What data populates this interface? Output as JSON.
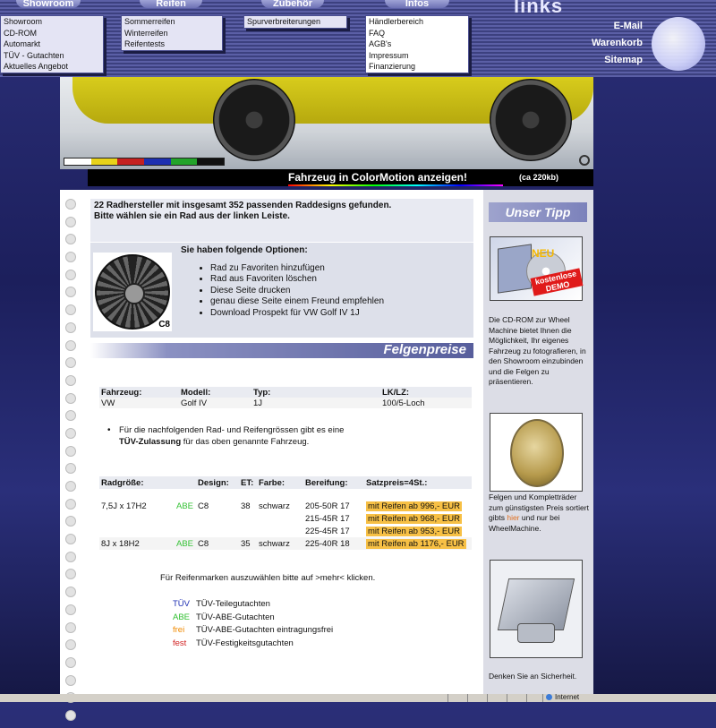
{
  "nav": {
    "tabs": [
      {
        "label": "Showroom"
      },
      {
        "label": "Reifen"
      },
      {
        "label": "Zubehör"
      },
      {
        "label": "Infos"
      }
    ],
    "logo": "links",
    "menus": {
      "showroom": [
        "Showroom",
        "CD-ROM",
        "Automarkt",
        "TÜV - Gutachten",
        "Aktuelles Angebot"
      ],
      "reifen": [
        "Sommerreifen",
        "Winterreifen",
        "Reifentests"
      ],
      "zubehoer": [
        "Spurverbreiterungen"
      ],
      "infos": [
        "Händlerbereich",
        "FAQ",
        "AGB's",
        "Impressum",
        "Finanzierung"
      ]
    },
    "right_links": [
      "E-Mail",
      "Warenkorb",
      "Sitemap"
    ]
  },
  "hero": {
    "colormotion_label": "Fahrzeug in ColorMotion anzeigen!",
    "colormotion_size": "(ca 220kb)",
    "swatch_colors": [
      "#ffffff",
      "#e8d21a",
      "#c42020",
      "#1d2fb0",
      "#23a32a",
      "#111111"
    ]
  },
  "intro": {
    "line1": "22 Radhersteller mit insgesamt 352 passenden Raddesigns gefunden.",
    "line2": "Bitte wählen sie ein Rad aus der linken Leiste."
  },
  "options": {
    "title": "Sie haben folgende Optionen:",
    "rim_label": "C8",
    "items": [
      "Rad zu Favoriten hinzufügen",
      "Rad aus Favoriten löschen",
      "Diese Seite drucken",
      "genau diese Seite einem Freund empfehlen",
      "Download Prospekt für VW Golf IV 1J"
    ]
  },
  "felgenpreise_title": "Felgenpreise",
  "vehicle": {
    "headers": [
      "Fahrzeug:",
      "Modell:",
      "Typ:",
      "LK/LZ:"
    ],
    "values": [
      "VW",
      "Golf IV",
      "1J",
      "100/5-Loch"
    ]
  },
  "note": {
    "text": "Für die nachfolgenden Rad- und Reifengrössen gibt es eine",
    "bold": "TÜV-Zulassung",
    "text2": "für das oben genannte Fahrzeug."
  },
  "sizes": {
    "headers": [
      "Radgröße:",
      "Design:",
      "ET:",
      "Farbe:",
      "Bereifung:",
      "Satzpreis=4St.:"
    ],
    "rows": [
      {
        "size": "7,5J x 17H2",
        "cert": "ABE",
        "design": "C8",
        "et": "38",
        "farbe": "schwarz",
        "tyre": "205-50R 17",
        "price": "mit Reifen ab 996,- EUR"
      },
      {
        "size": "",
        "cert": "",
        "design": "",
        "et": "",
        "farbe": "",
        "tyre": "215-45R 17",
        "price": "mit Reifen ab 968,- EUR"
      },
      {
        "size": "",
        "cert": "",
        "design": "",
        "et": "",
        "farbe": "",
        "tyre": "225-45R 17",
        "price": "mit Reifen ab 953,- EUR"
      },
      {
        "size": "8J x 18H2",
        "cert": "ABE",
        "design": "C8",
        "et": "35",
        "farbe": "schwarz",
        "tyre": "225-40R 18",
        "price": "mit Reifen ab 1176,- EUR"
      }
    ]
  },
  "pick_text": "Für Reifenmarken auszuwählen bitte auf >mehr< klicken.",
  "legend": [
    {
      "key": "TÜV",
      "color": "#1e2fb3",
      "text": "TÜV-Teilegutachten"
    },
    {
      "key": "ABE",
      "color": "#2fbf2f",
      "text": "TÜV-ABE-Gutachten"
    },
    {
      "key": "frei",
      "color": "#f08a00",
      "text": "TÜV-ABE-Gutachten eintragungsfrei"
    },
    {
      "key": "fest",
      "color": "#d11f1f",
      "text": "TÜV-Festigkeitsgutachten"
    }
  ],
  "sidebar": {
    "title": "Unser Tipp",
    "cd_text": "Die CD-ROM zur Wheel Machine bietet Ihnen die Möglichkeit, Ihr eigenes Fahrzeug zu fotografieren, in den Showroom einzubinden und die Felgen zu präsentieren.",
    "cd_badge_neu": "NEU",
    "cd_badge_demo": "kostenlose DEMO",
    "coin_text_1": "Felgen und Kompletträder zum günstigsten Preis sortiert gibts",
    "coin_hier": "hier",
    "coin_text_2": "und nur bei WheelMachine.",
    "lock_text": "Denken Sie an Sicherheit."
  },
  "status": {
    "zone": "Internet"
  }
}
